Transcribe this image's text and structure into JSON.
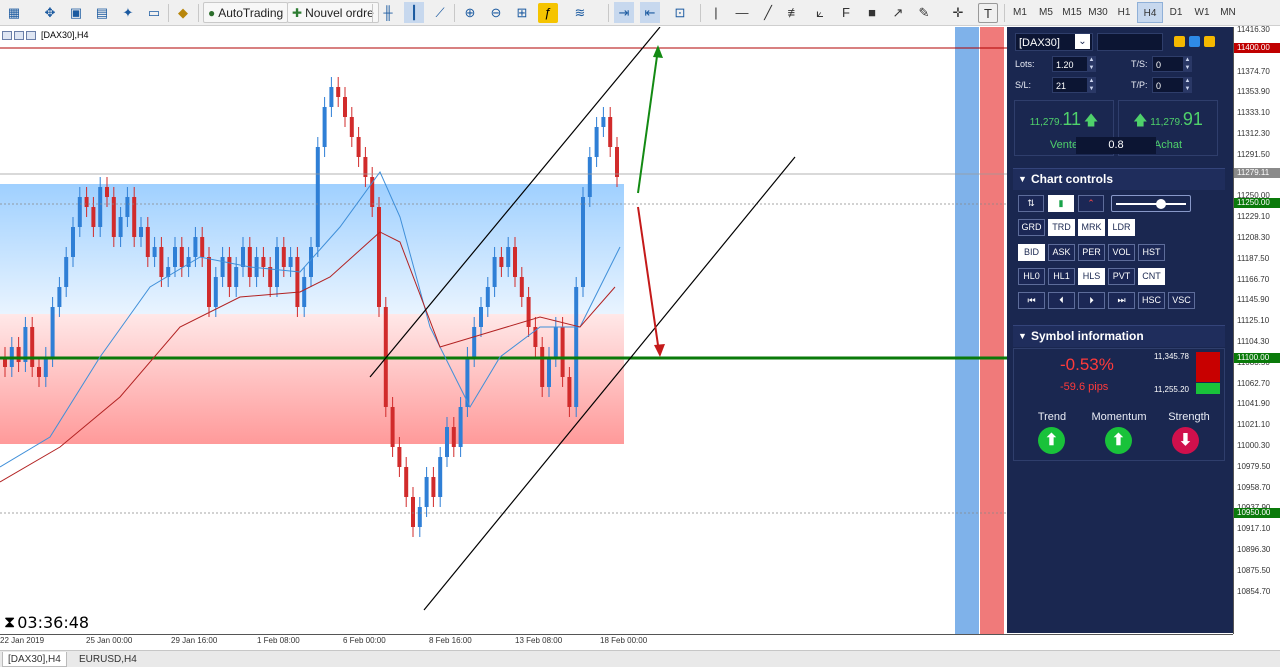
{
  "toolbar": {
    "autotrading_label": "AutoTrading",
    "new_order_label": "Nouvel ordre",
    "timeframes": [
      "M1",
      "M5",
      "M15",
      "M30",
      "H1",
      "H4",
      "D1",
      "W1",
      "MN"
    ],
    "active_timeframe": "H4"
  },
  "chart": {
    "title": "[DAX30],H4",
    "timer": "03:36:48"
  },
  "price_axis": {
    "labels": [
      "11416.30",
      "11395.35",
      "11374.70",
      "11353.90",
      "11333.10",
      "11312.30",
      "11291.50",
      "11270.70",
      "11250.00",
      "11229.10",
      "11208.30",
      "11187.50",
      "11166.70",
      "11145.90",
      "11125.10",
      "11104.30",
      "11083.50",
      "11062.70",
      "11041.90",
      "11021.10",
      "11000.30",
      "10979.50",
      "10958.70",
      "10937.90",
      "10917.10",
      "10896.30",
      "10875.50",
      "10854.70"
    ],
    "tag_top": "11400.00",
    "tag_current": "11279.11",
    "tag_250": "11250.00",
    "tag_100": "11100.00",
    "tag_950": "10950.00",
    "colors": {
      "red": "#c00000",
      "green": "#0a7a0a",
      "grey": "#8a8a8a"
    }
  },
  "time_axis": {
    "labels": [
      "22 Jan 2019",
      "25 Jan 00:00",
      "29 Jan 16:00",
      "1 Feb 08:00",
      "6 Feb 00:00",
      "8 Feb 16:00",
      "13 Feb 08:00",
      "18 Feb 00:00"
    ]
  },
  "tabs": [
    "[DAX30],H4",
    "EURUSD,H4"
  ],
  "panel": {
    "symbol": "[DAX30]",
    "lots_label": "Lots:",
    "lots_value": "1.20",
    "sl_label": "S/L:",
    "sl_value": "21",
    "ts_label": "T/S:",
    "ts_value": "0",
    "tp_label": "T/P:",
    "tp_value": "0",
    "sell": {
      "price_prefix": "11,279.",
      "price_big": "11",
      "label": "Vente"
    },
    "buy": {
      "price_prefix": "11,279.",
      "price_big": "91",
      "label": "Achat"
    },
    "spread": "0.8",
    "chart_controls_title": "Chart controls",
    "row1": [
      "GRD",
      "TRD",
      "MRK",
      "LDR"
    ],
    "row2": [
      "BID",
      "ASK",
      "PER",
      "VOL",
      "HST"
    ],
    "row3": [
      "HL0",
      "HL1",
      "HLS",
      "PVT",
      "CNT"
    ],
    "row4": [
      "⏮",
      "⏴",
      "⏵",
      "⏭",
      "HSC",
      "VSC"
    ],
    "symbol_info_title": "Symbol information",
    "change_pct": "-0.53%",
    "change_pips": "-59.6 pips",
    "high": "11,345.78",
    "low": "11,255.20",
    "trend_label": "Trend",
    "momentum_label": "Momentum",
    "strength_label": "Strength",
    "colors": {
      "panel_bg": "#1a2750",
      "green": "#19c23a",
      "red_text": "#ff3a3a",
      "pink": "#d0104c"
    }
  }
}
